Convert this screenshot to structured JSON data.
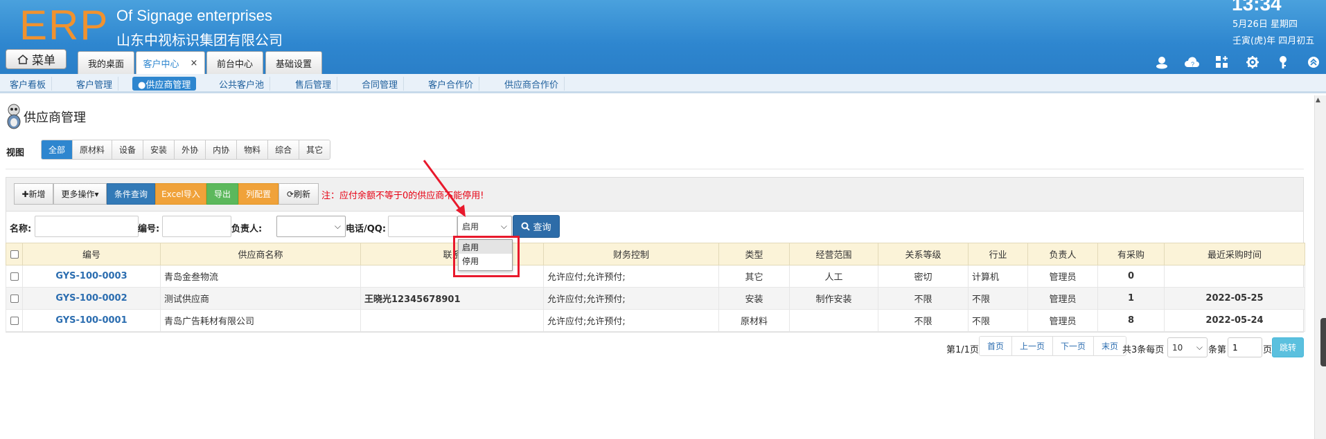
{
  "header": {
    "logo": "ERP",
    "brand_en": "Of Signage enterprises",
    "brand_cn": "山东中视标识集团有限公司",
    "time": "13:34",
    "date": "5月26日 星期四",
    "lunar": "壬寅(虎)年 四月初五",
    "menu_label": "菜单",
    "tabs": [
      {
        "label": "我的桌面"
      },
      {
        "label": "客户中心",
        "close": "×"
      },
      {
        "label": "前台中心"
      },
      {
        "label": "基础设置"
      }
    ],
    "icons": [
      "user-icon",
      "cloud-help-icon",
      "grid-add-icon",
      "gear-icon",
      "key-icon",
      "collapse-icon"
    ]
  },
  "subnav": [
    {
      "label": "客户看板"
    },
    {
      "label": "客户管理"
    },
    {
      "label": "●供应商管理"
    },
    {
      "label": "公共客户池"
    },
    {
      "label": "售后管理"
    },
    {
      "label": "合同管理"
    },
    {
      "label": "客户合作价"
    },
    {
      "label": "供应商合作价"
    }
  ],
  "page": {
    "title": "供应商管理",
    "view_label": "视图",
    "views": [
      "全部",
      "原材料",
      "设备",
      "安装",
      "外协",
      "内协",
      "物料",
      "综合",
      "其它"
    ]
  },
  "toolbar": {
    "add": "✚新增",
    "more": "更多操作▾",
    "filter": "条件查询",
    "excel_import": "Excel导入",
    "export": "导出",
    "columns": "列配置",
    "refresh": "⟳刷新",
    "note": "注：应付余额不等于0的供应商不能停用!"
  },
  "search": {
    "name_label": "名称:",
    "code_label": "编号:",
    "owner_label": "负责人:",
    "phone_label": "电话/QQ:",
    "status_value": "启用",
    "query_label": "查询",
    "status_options": [
      "启用",
      "停用"
    ]
  },
  "table": {
    "headers": [
      "编号",
      "供应商名称",
      "联系",
      "财务控制",
      "类型",
      "经营范围",
      "关系等级",
      "行业",
      "负责人",
      "有采购",
      "最近采购时间"
    ],
    "rows": [
      {
        "code": "GYS-100-0003",
        "name": "青岛金叁物流",
        "contact": "",
        "finance": "允许应付;允许预付;",
        "type": "其它",
        "scope": "人工",
        "level": "密切",
        "industry": "计算机",
        "owner": "管理员",
        "purchases": "0",
        "last": ""
      },
      {
        "code": "GYS-100-0002",
        "name": "测试供应商",
        "contact": "王晓光12345678901",
        "finance": "允许应付;允许预付;",
        "type": "安装",
        "scope": "制作安装",
        "level": "不限",
        "industry": "不限",
        "owner": "管理员",
        "purchases": "1",
        "last": "2022-05-25"
      },
      {
        "code": "GYS-100-0001",
        "name": "青岛广告耗材有限公司",
        "contact": "",
        "finance": "允许应付;允许预付;",
        "type": "原材料",
        "scope": "",
        "level": "不限",
        "industry": "不限",
        "owner": "管理员",
        "purchases": "8",
        "last": "2022-05-24"
      }
    ]
  },
  "pagination": {
    "page_info": "第1/1页",
    "first": "首页",
    "prev": "上一页",
    "next": "下一页",
    "last": "末页",
    "total": "共3条每页",
    "page_size": "10",
    "per_suffix": "条第",
    "page_value": "1",
    "page_suffix": "页",
    "jump": "跳转"
  },
  "colors": {
    "header_blue": "#2e86cf",
    "logo_orange": "#f0922f",
    "note_red": "#e60012",
    "highlight_red": "#e8192c"
  }
}
